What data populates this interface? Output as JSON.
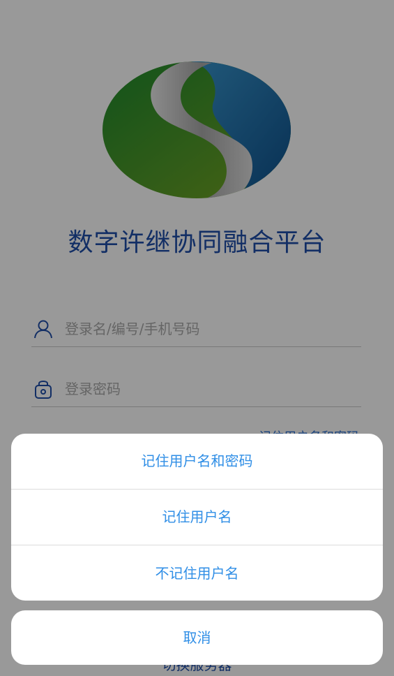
{
  "app": {
    "title": "数字许继协同融合平台"
  },
  "login": {
    "username_placeholder": "登录名/编号/手机号码",
    "password_placeholder": "登录密码",
    "remember_link": "记住用户名和密码",
    "switch_server": "切换服务器"
  },
  "icons": {
    "username": "user-icon",
    "password": "lock-icon"
  },
  "action_sheet": {
    "items": [
      {
        "label": "记住用户名和密码"
      },
      {
        "label": "记住用户名"
      },
      {
        "label": "不记住用户名"
      }
    ],
    "cancel_label": "取消"
  },
  "colors": {
    "title": "#1f4ea8",
    "action": "#2f8ee6",
    "logo_green": "#2a8a2a",
    "logo_blue": "#0f5e9a"
  }
}
